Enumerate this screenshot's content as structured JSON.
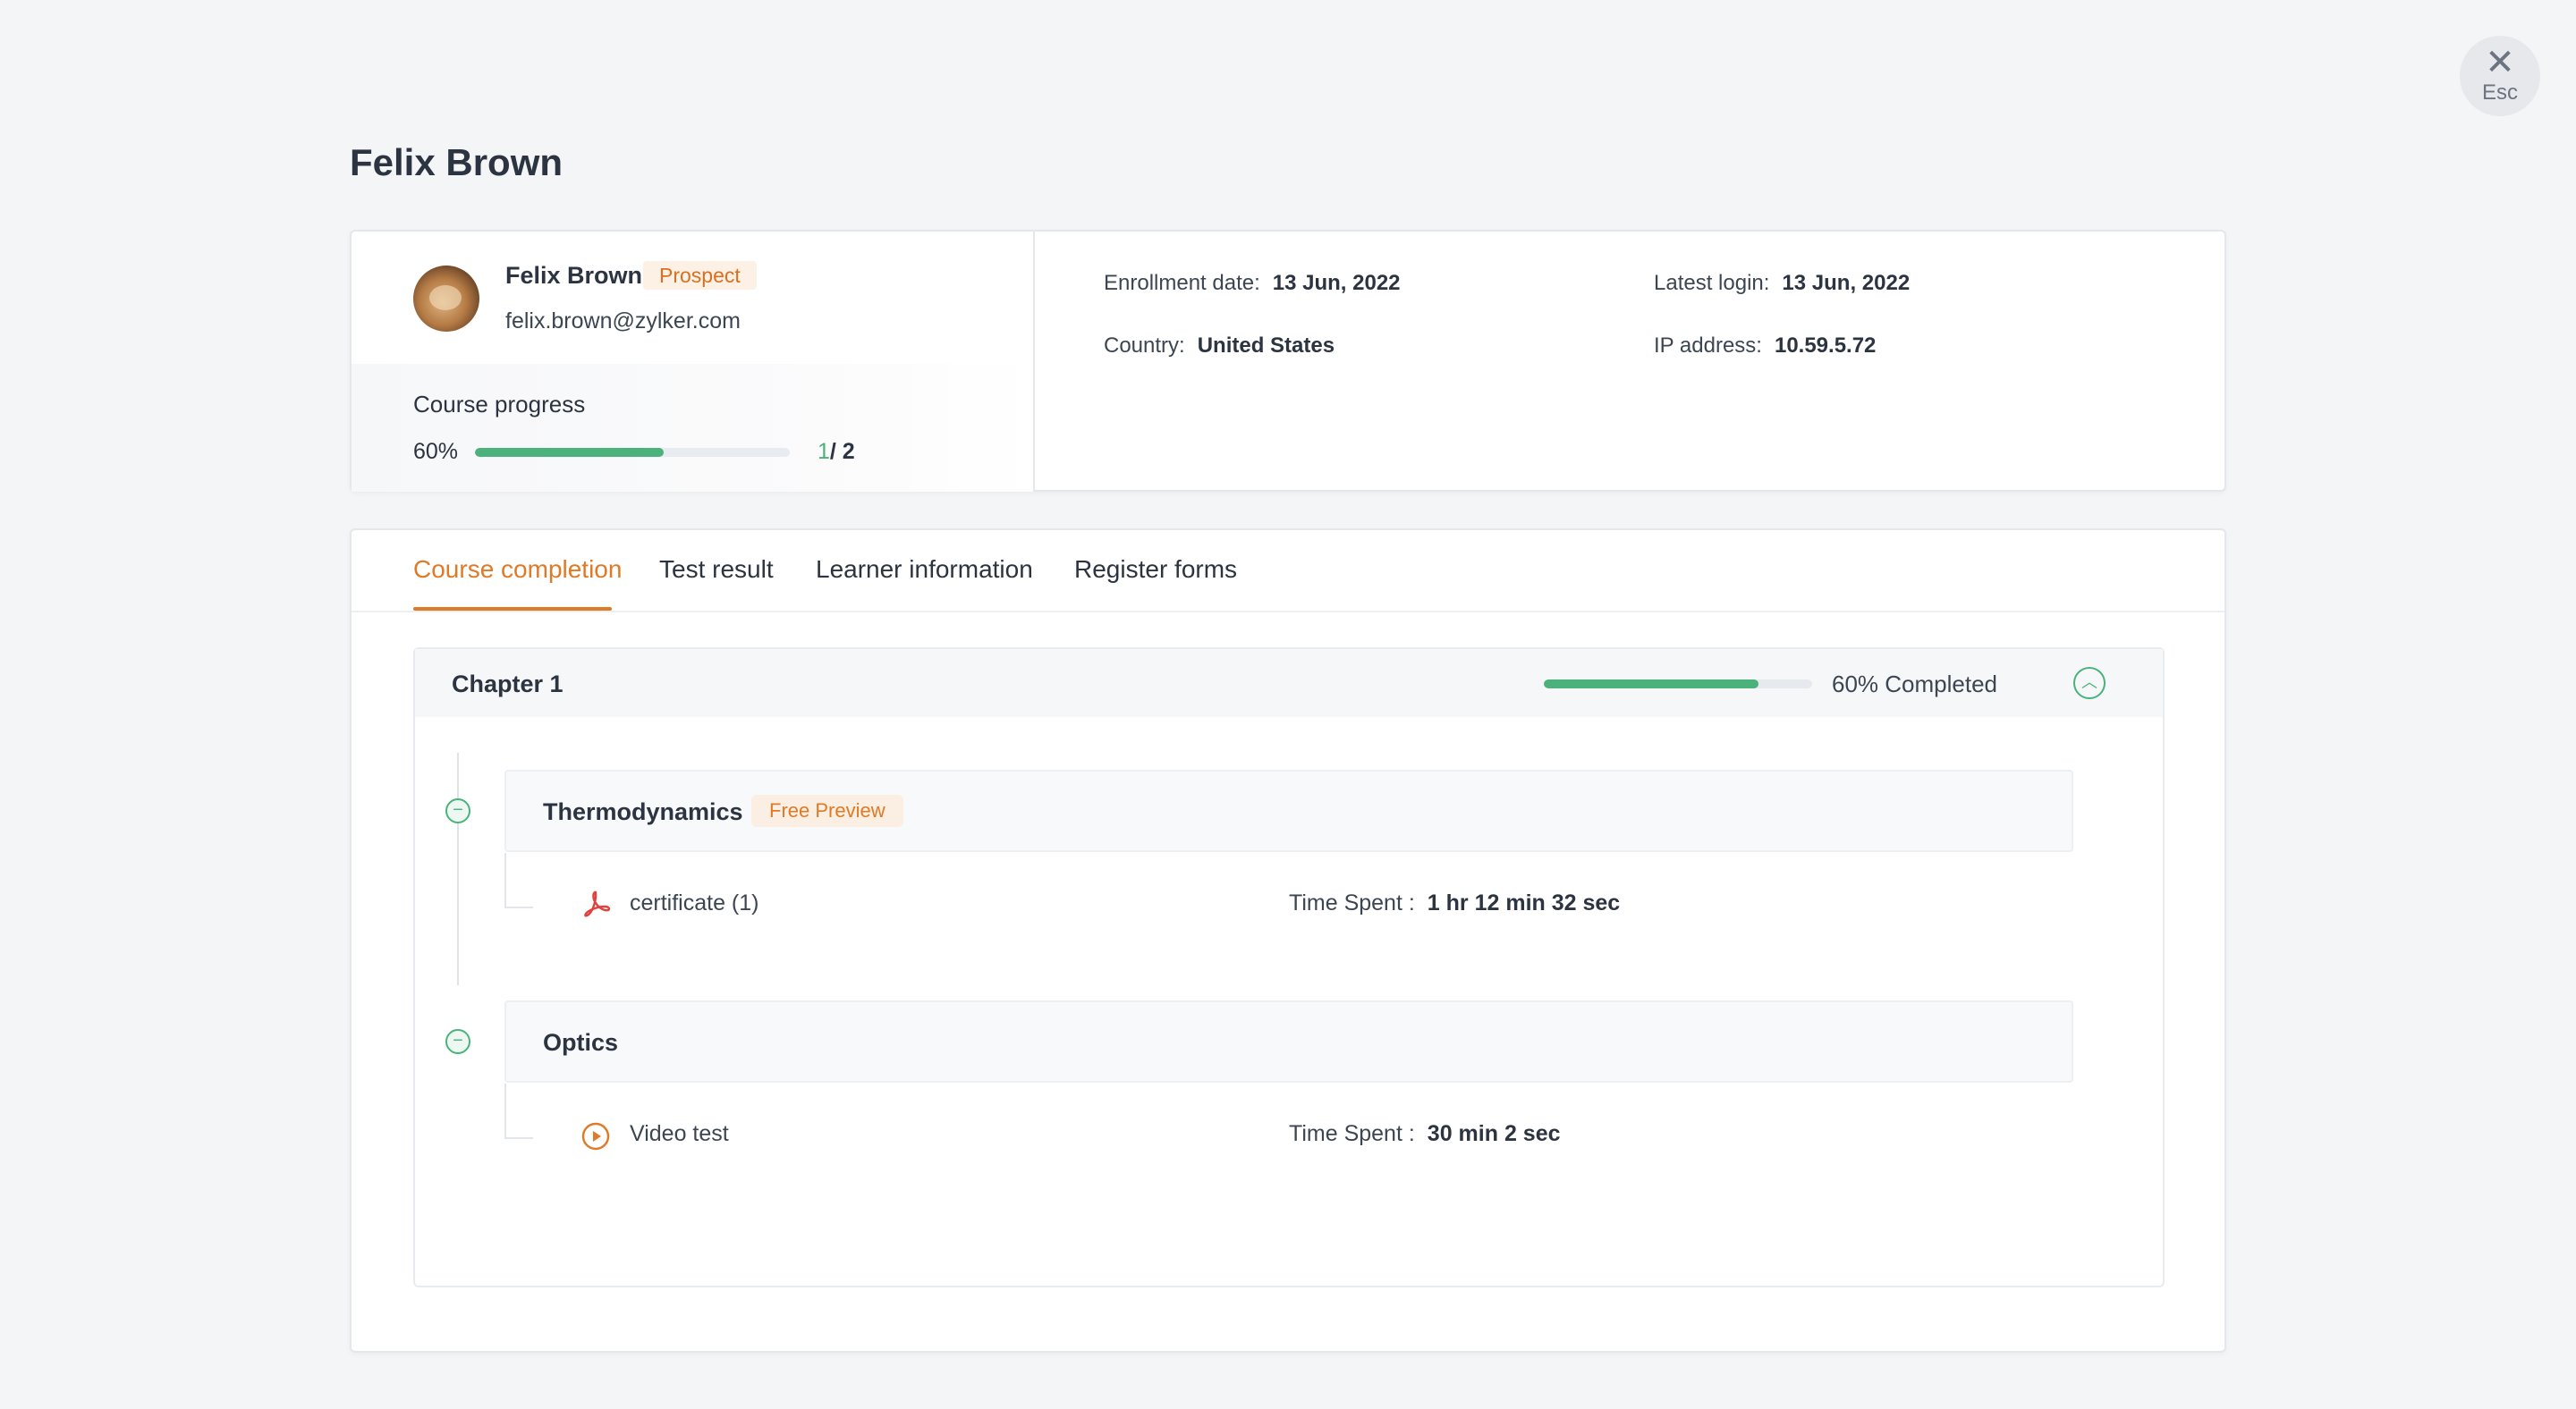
{
  "esc": {
    "label": "Esc"
  },
  "page": {
    "title": "Felix Brown"
  },
  "profile": {
    "name": "Felix Brown",
    "badge": "Prospect",
    "email": "felix.brown@zylker.com",
    "progress_label": "Course progress",
    "progress_percent": "60%",
    "progress_value": 60,
    "completed": "1",
    "total": "/ 2"
  },
  "info": {
    "enrollment_label": "Enrollment date:",
    "enrollment_value": "13 Jun, 2022",
    "login_label": "Latest login:",
    "login_value": "13 Jun, 2022",
    "country_label": "Country:",
    "country_value": "United States",
    "ip_label": "IP address:",
    "ip_value": "10.59.5.72"
  },
  "tabs": [
    {
      "label": "Course completion",
      "active": true
    },
    {
      "label": "Test result",
      "active": false
    },
    {
      "label": "Learner information",
      "active": false
    },
    {
      "label": "Register forms",
      "active": false
    }
  ],
  "chapter": {
    "title": "Chapter 1",
    "progress_value": 80,
    "completed_label": "60% Completed",
    "lessons": [
      {
        "title": "Thermodynamics",
        "badge": "Free Preview",
        "item_name": "certificate (1)",
        "item_icon": "pdf-icon",
        "time_label": "Time Spent :",
        "time_value": "1 hr 12 min 32 sec"
      },
      {
        "title": "Optics",
        "badge": "",
        "item_name": "Video test",
        "item_icon": "play-icon",
        "time_label": "Time Spent :",
        "time_value": "30 min 2 sec"
      }
    ]
  },
  "colors": {
    "accent": "#e07a26",
    "success": "#4cb27b",
    "text": "#2b3440"
  }
}
